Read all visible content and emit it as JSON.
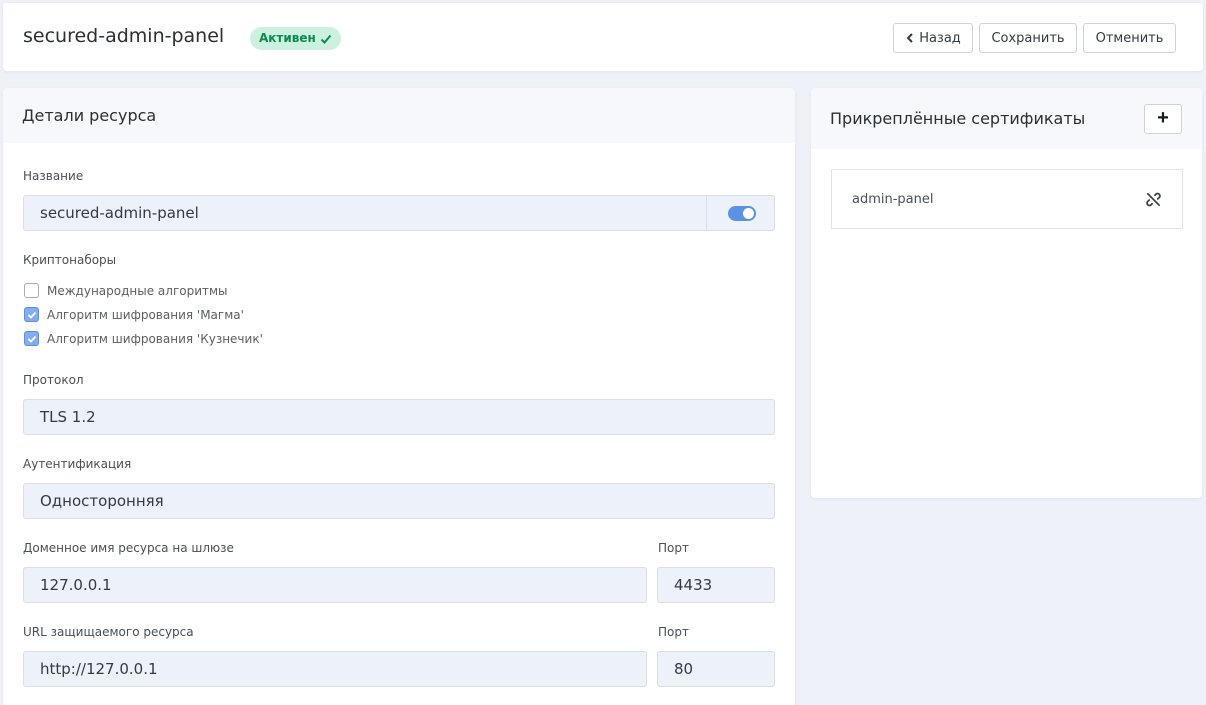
{
  "header": {
    "title": "secured-admin-panel",
    "status": "Активен",
    "back_label": "Назад",
    "save_label": "Сохранить",
    "cancel_label": "Отменить"
  },
  "details": {
    "title": "Детали ресурса",
    "name_label": "Название",
    "name_value": "secured-admin-panel",
    "crypto_label": "Криптонаборы",
    "crypto_options": [
      {
        "label": "Международные алгоритмы",
        "checked": false
      },
      {
        "label": "Алгоритм шифрования 'Магма'",
        "checked": true
      },
      {
        "label": "Алгоритм шифрования 'Кузнечик'",
        "checked": true
      }
    ],
    "protocol_label": "Протокол",
    "protocol_value": "TLS 1.2",
    "auth_label": "Аутентификация",
    "auth_value": "Односторонняя",
    "gateway_label": "Доменное имя ресурса на шлюзе",
    "gateway_value": "127.0.0.1",
    "gateway_port_label": "Порт",
    "gateway_port_value": "4433",
    "url_label": "URL защищаемого ресурса",
    "url_value": "http://127.0.0.1",
    "url_port_label": "Порт",
    "url_port_value": "80"
  },
  "certificates": {
    "title": "Прикреплённые сертификаты",
    "add_label": "+",
    "items": [
      {
        "name": "admin-panel",
        "action_icon": "unlink-icon"
      }
    ]
  },
  "colors": {
    "accent": "#5a92e6",
    "status_bg": "#ccf2df",
    "status_text": "#0d8a52"
  }
}
